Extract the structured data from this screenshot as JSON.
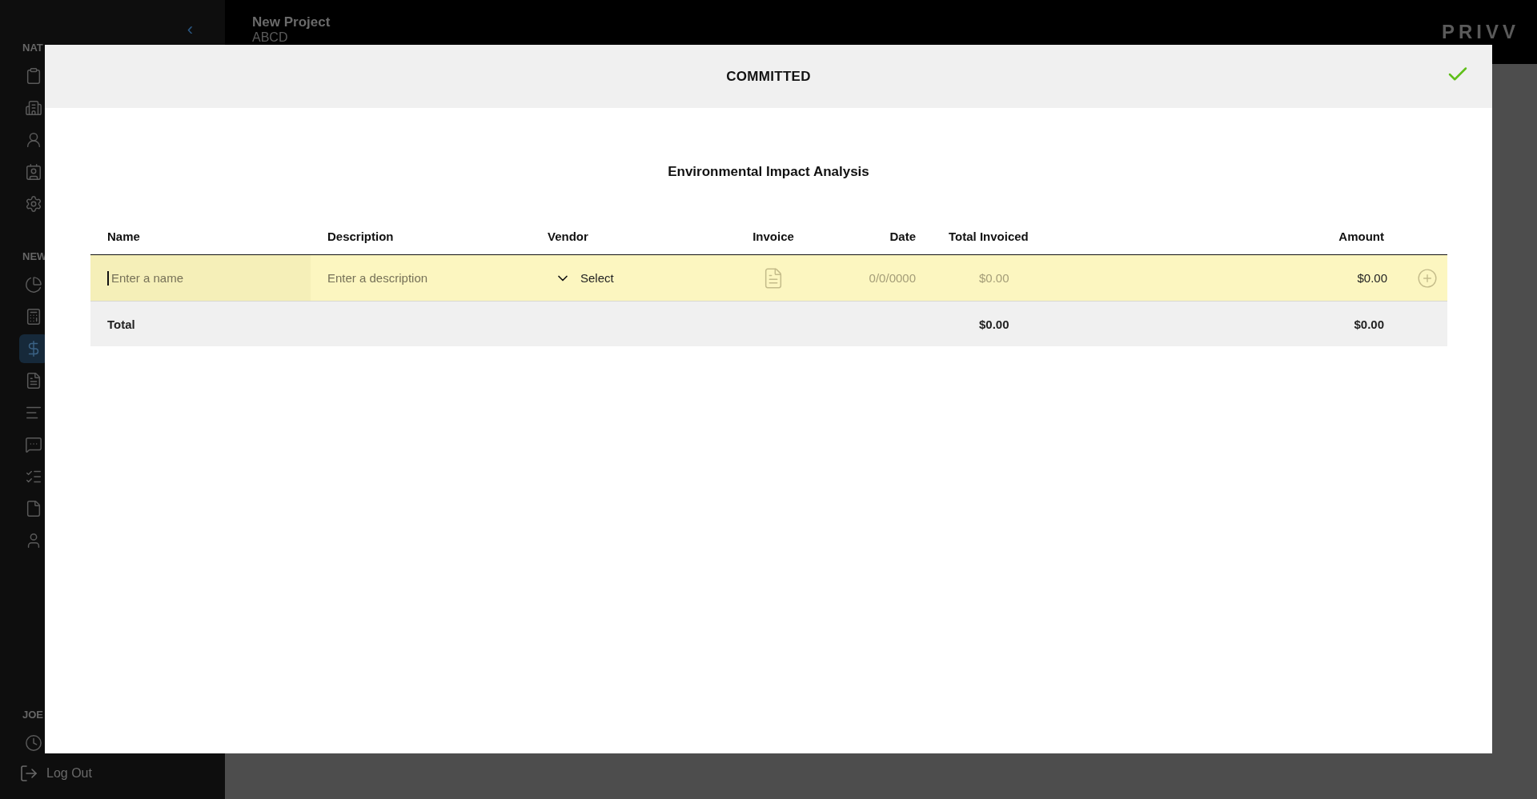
{
  "sidebar": {
    "collapse_button": "‹",
    "sections": [
      {
        "label": "NAT",
        "items": [
          {
            "selected": false
          },
          {
            "selected": false
          },
          {
            "selected": false
          },
          {
            "selected": false
          },
          {
            "selected": false
          }
        ]
      },
      {
        "label": "NEW",
        "items": [
          {
            "selected": false
          },
          {
            "selected": false
          },
          {
            "selected": true
          },
          {
            "selected": false
          },
          {
            "selected": false
          },
          {
            "selected": false
          },
          {
            "selected": false
          },
          {
            "selected": false
          },
          {
            "selected": false
          }
        ]
      },
      {
        "label": "JOE",
        "items": [
          {
            "selected": false
          }
        ]
      }
    ],
    "logout": "Log Out"
  },
  "header": {
    "project_title": "New Project",
    "project_code": "ABCD",
    "logo": "PRIVV"
  },
  "modal": {
    "title": "COMMITTED",
    "subtitle": "Environmental Impact Analysis",
    "columns": [
      "Name",
      "Description",
      "Vendor",
      "Invoice",
      "Date",
      "Total Invoiced",
      "Amount"
    ],
    "entry_row": {
      "name": {
        "placeholder": "Enter a name"
      },
      "description": {
        "placeholder": "Enter a description"
      },
      "vendor": "Select",
      "date": {
        "placeholder": "0/0/0000"
      },
      "total_invoiced": {
        "placeholder": "$0.00"
      },
      "amount": "$0.00"
    },
    "total_row": {
      "label": "Total",
      "total_invoiced": "$0.00",
      "amount": "$0.00"
    }
  }
}
